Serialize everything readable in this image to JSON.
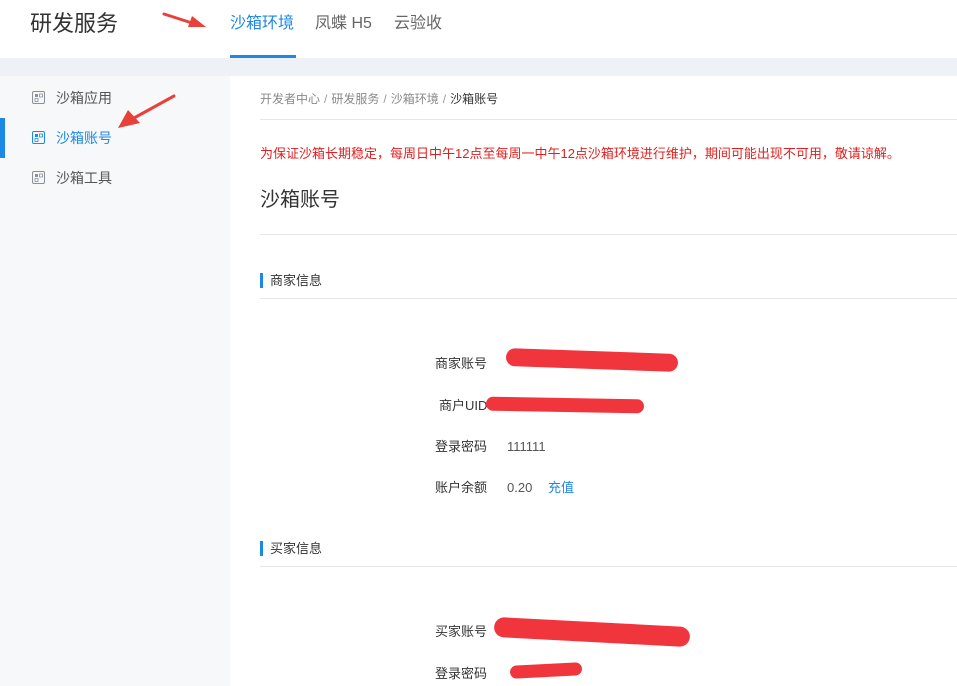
{
  "header": {
    "brand": "研发服务",
    "tabs": [
      {
        "label": "沙箱环境",
        "active": true
      },
      {
        "label": "凤蝶 H5",
        "active": false
      },
      {
        "label": "云验收",
        "active": false
      }
    ]
  },
  "sidebar": {
    "items": [
      {
        "label": "沙箱应用",
        "icon": "app-icon",
        "active": false
      },
      {
        "label": "沙箱账号",
        "icon": "app-icon",
        "active": true
      },
      {
        "label": "沙箱工具",
        "icon": "app-icon",
        "active": false
      }
    ]
  },
  "breadcrumb": [
    "开发者中心",
    "研发服务",
    "沙箱环境",
    "沙箱账号"
  ],
  "notice": "为保证沙箱长期稳定，每周日中午12点至每周一中午12点沙箱环境进行维护，期间可能出现不可用，敬请谅解。",
  "page_title": "沙箱账号",
  "merchant": {
    "title": "商家信息",
    "account_label": "商家账号",
    "uid_label": "商户UID",
    "password_label": "登录密码",
    "password_value": "111111",
    "balance_label": "账户余额",
    "balance_value": "0.20",
    "recharge_label": "充值"
  },
  "buyer": {
    "title": "买家信息",
    "account_label": "买家账号",
    "password_label": "登录密码"
  },
  "colors": {
    "accent": "#1e88e5",
    "notice": "#e02020",
    "redaction": "#f1353d",
    "annotation_arrow": "#e8403a"
  }
}
